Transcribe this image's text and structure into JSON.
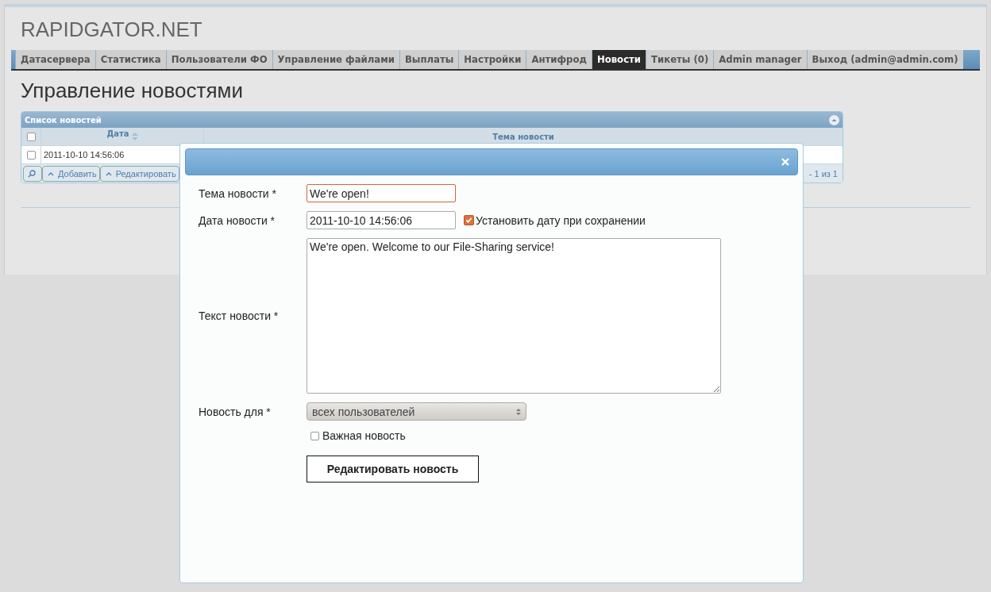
{
  "site": {
    "logo": "RAPIDGATOR.NET"
  },
  "nav": [
    {
      "label": "Датасервера",
      "selected": false
    },
    {
      "label": "Статистика",
      "selected": false
    },
    {
      "label": "Пользователи ФО",
      "selected": false
    },
    {
      "label": "Управление файлами",
      "selected": false
    },
    {
      "label": "Выплаты",
      "selected": false
    },
    {
      "label": "Настройки",
      "selected": false
    },
    {
      "label": "Антифрод",
      "selected": false
    },
    {
      "label": "Новости",
      "selected": true
    },
    {
      "label": "Тикеты (0)",
      "selected": false
    },
    {
      "label": "Admin manager",
      "selected": false
    },
    {
      "label": "Выход (admin@admin.com)",
      "selected": false
    }
  ],
  "page": {
    "title": "Управление новостями"
  },
  "news_grid": {
    "caption": "Список новостей",
    "select_all_checked": false,
    "columns": [
      {
        "label": "Дата",
        "sortable": true
      },
      {
        "label": "Тема новости",
        "sortable": false
      }
    ],
    "rows": [
      {
        "checked": false,
        "date": "2011-10-10 14:56:06"
      }
    ],
    "toolbar": [
      {
        "kind": "search"
      },
      {
        "kind": "text",
        "label": "Добавить"
      },
      {
        "kind": "text",
        "label": "Редактировать"
      }
    ],
    "pager": "- 1 из 1"
  },
  "dialog": {
    "fields": [
      {
        "kind": "text",
        "label": "Тема новости *",
        "value": "We're open!",
        "focused": true
      },
      {
        "kind": "text",
        "label": "Дата новости *",
        "value": "2011-10-10 14:56:06",
        "focused": false,
        "option": {
          "label": "Установить дату при сохранении",
          "checked": true
        }
      },
      {
        "kind": "textarea",
        "label": "Текст новости *",
        "value": "We're open. Welcome to our File-Sharing service!"
      },
      {
        "kind": "select",
        "label": "Новость для *",
        "value": "всех пользователей"
      },
      {
        "kind": "checkbox",
        "label": "Важная новость",
        "checked": false
      }
    ],
    "submit": "Редактировать новость"
  }
}
